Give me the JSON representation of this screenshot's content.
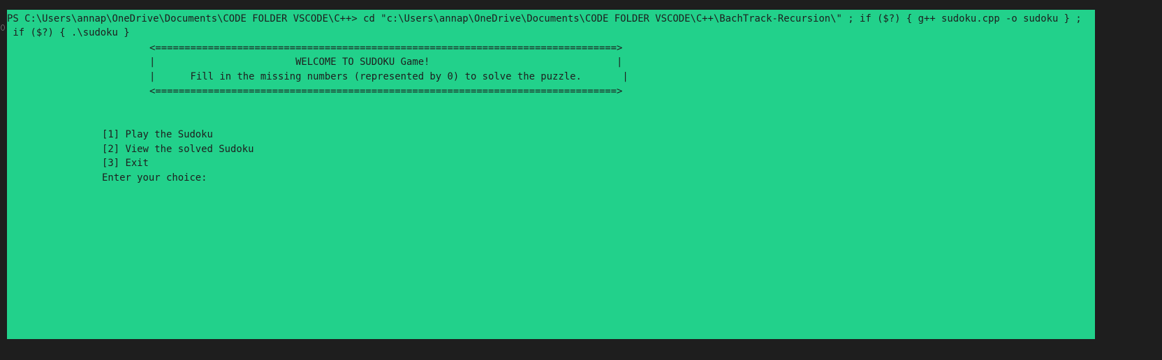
{
  "terminal": {
    "command_line_1": "PS C:\\Users\\annap\\OneDrive\\Documents\\CODE FOLDER VSCODE\\C++> cd \"c:\\Users\\annap\\OneDrive\\Documents\\CODE FOLDER VSCODE\\C++\\BachTrack-Recursion\\\" ; if ($?) { g++ sudoku.cpp -o sudoku } ;",
    "command_line_2": " if ($?) { .\\sudoku }",
    "background_color": "#22d18b",
    "text_color": "#1e1e1e"
  },
  "banner": {
    "top_border": "<===============================================================================>",
    "title_line": "|                        WELCOME TO SUDOKU Game!                                |",
    "subtitle_line": "|      Fill in the missing numbers (represented by 0) to solve the puzzle.       |",
    "bottom_border": "<===============================================================================>"
  },
  "menu": {
    "option_1": "[1] Play the Sudoku",
    "option_2": "[2] View the solved Sudoku",
    "option_3": "[3] Exit",
    "prompt": "Enter your choice:",
    "input_value": ""
  }
}
